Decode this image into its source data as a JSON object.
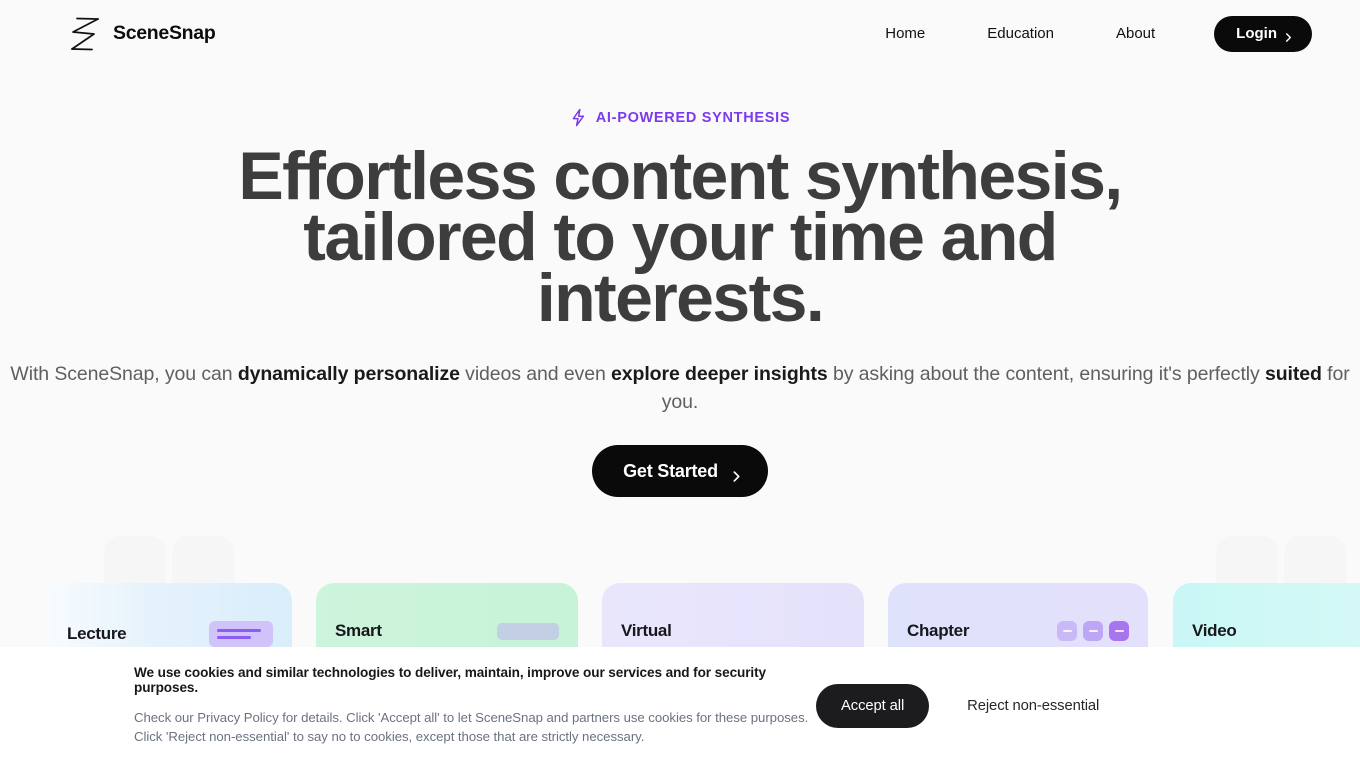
{
  "brand": {
    "name": "SceneSnap",
    "logo_icon": "scenesnap-zigzag-logo"
  },
  "nav": {
    "links": [
      {
        "label": "Home"
      },
      {
        "label": "Education"
      },
      {
        "label": "About"
      }
    ],
    "login_label": "Login",
    "login_icon": "chevron-right-icon"
  },
  "hero": {
    "badge_icon": "lightning-bolt-icon",
    "badge_text": "AI-POWERED SYNTHESIS",
    "headline": "Effortless content synthesis, tailored to your time and interests.",
    "subline": {
      "part1": "With SceneSnap, you can ",
      "bold1": "dynamically personalize",
      "part2": " videos and even ",
      "bold2": "explore deeper insights",
      "part3": " by asking about the content, ensuring it's perfectly ",
      "bold3": "suited",
      "part4": " for you."
    },
    "cta_label": "Get Started",
    "cta_icon": "chevron-right-icon"
  },
  "cards": [
    {
      "title": "Lecture",
      "icon": "text-lines-icon"
    },
    {
      "title": "Smart",
      "icon": "bar-icon"
    },
    {
      "title": "Virtual",
      "icon": "none"
    },
    {
      "title": "Chapter",
      "icon": "chips-icon"
    },
    {
      "title": "Video",
      "icon": "none"
    }
  ],
  "cookie": {
    "heading": "We use cookies and similar technologies to deliver, maintain, improve our services and for security purposes.",
    "line1": "Check our Privacy Policy for details. Click 'Accept all' to let SceneSnap and partners use cookies for these purposes.",
    "line2": "Click 'Reject non-essential' to say no to cookies, except those that are strictly necessary.",
    "accept_label": "Accept all",
    "reject_label": "Reject non-essential"
  },
  "colors": {
    "accent_purple": "#7c3aed",
    "button_black": "#0a0a0a",
    "page_bg": "#fafafa",
    "heading": "#3d3d3d",
    "card_lecture": "#ddeefc",
    "card_smart": "#c9f5da",
    "card_virtual": "#e7e4fb",
    "card_chapter": "#dcdffb",
    "card_video": "#cdf7f7"
  }
}
